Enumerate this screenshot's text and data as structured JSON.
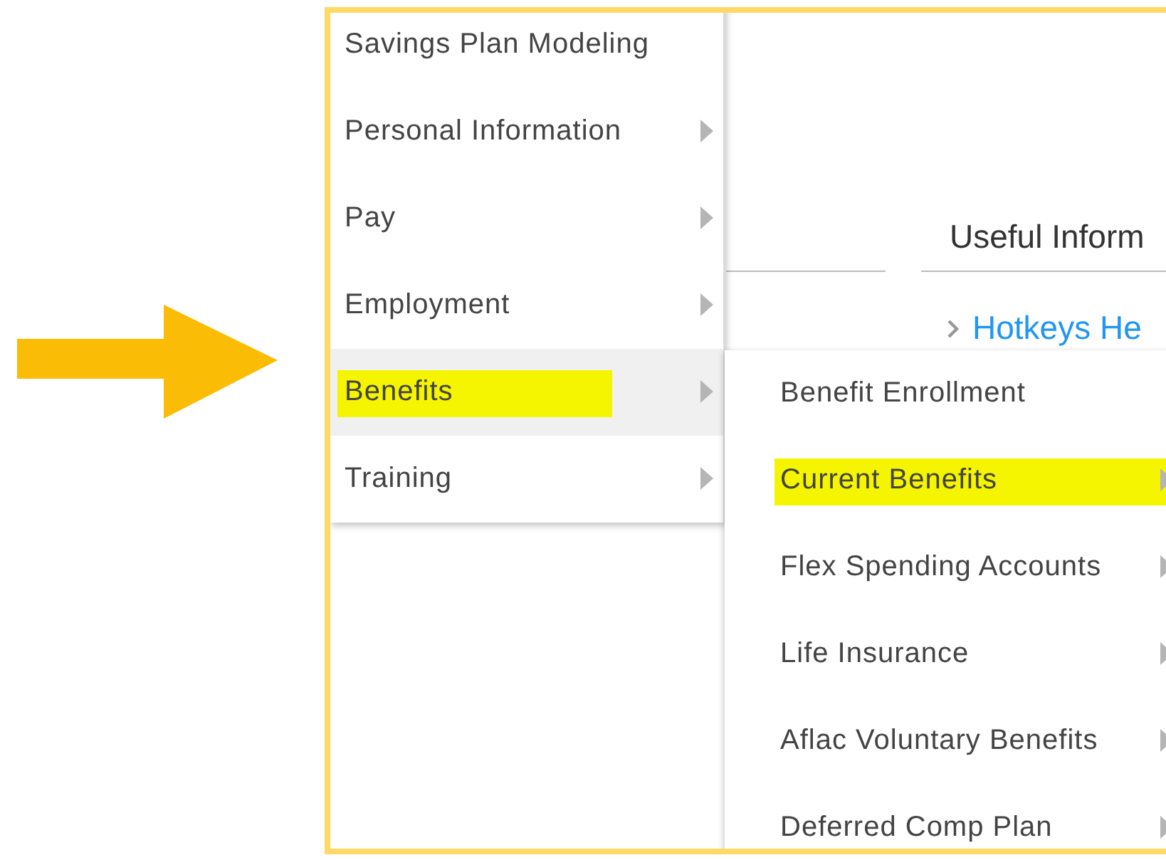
{
  "menu": {
    "items": [
      {
        "label": "Savings Plan Modeling",
        "has_submenu": false,
        "selected": false,
        "highlighted": false
      },
      {
        "label": "Personal Information",
        "has_submenu": true,
        "selected": false,
        "highlighted": false
      },
      {
        "label": "Pay",
        "has_submenu": true,
        "selected": false,
        "highlighted": false
      },
      {
        "label": "Employment",
        "has_submenu": true,
        "selected": false,
        "highlighted": false
      },
      {
        "label": "Benefits",
        "has_submenu": true,
        "selected": true,
        "highlighted": true
      },
      {
        "label": "Training",
        "has_submenu": true,
        "selected": false,
        "highlighted": false
      }
    ]
  },
  "submenu": {
    "items": [
      {
        "label": "Benefit Enrollment",
        "has_submenu": false,
        "highlighted": false
      },
      {
        "label": "Current Benefits",
        "has_submenu": true,
        "highlighted": true
      },
      {
        "label": "Flex Spending Accounts",
        "has_submenu": true,
        "highlighted": false
      },
      {
        "label": "Life Insurance",
        "has_submenu": true,
        "highlighted": false
      },
      {
        "label": "Aflac Voluntary Benefits",
        "has_submenu": true,
        "highlighted": false
      },
      {
        "label": "Deferred Comp Plan",
        "has_submenu": true,
        "highlighted": false
      }
    ]
  },
  "page": {
    "heading": "Useful Inform",
    "link": "Hotkeys He"
  }
}
